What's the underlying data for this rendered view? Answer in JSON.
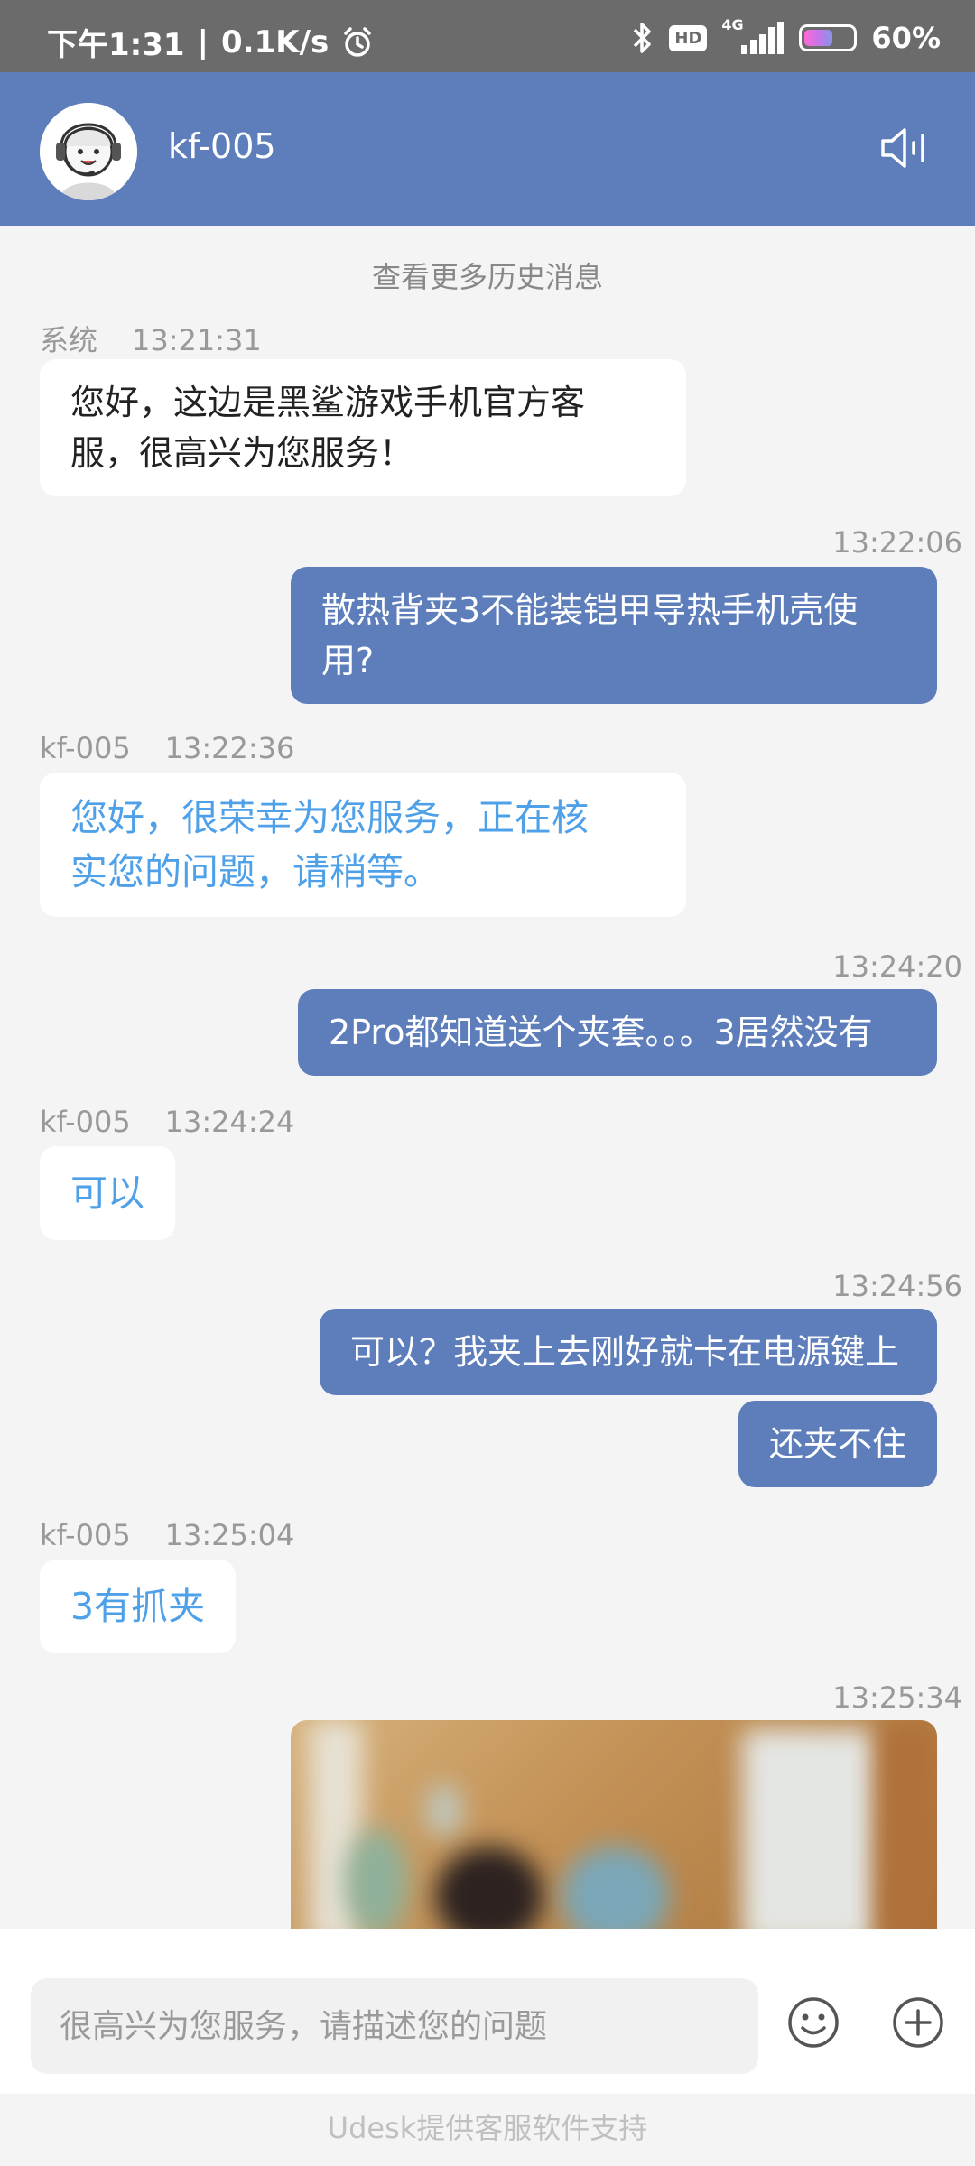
{
  "status_bar": {
    "time": "下午1:31",
    "separator": "|",
    "speed": "0.1K/s",
    "network": "4G",
    "hd": "HD",
    "battery": "60%",
    "battery_level": 0.6
  },
  "header": {
    "agent_name": "kf-005"
  },
  "chat": {
    "more_history": "查看更多历史消息",
    "messages": [
      {
        "sender": "系统",
        "time": "13:21:31",
        "lines": [
          "您好，这边是黑鲨游戏手机官方客",
          "服，很高兴为您服务！"
        ]
      },
      {
        "time": "13:22:06",
        "lines": [
          "散热背夹3不能装铠甲导热手机壳使",
          "用?"
        ]
      },
      {
        "sender": "kf-005",
        "time": "13:22:36",
        "lines": [
          "您好，很荣幸为您服务，正在核",
          "实您的问题，请稍等。"
        ]
      },
      {
        "time": "13:24:20",
        "text": "2Pro都知道送个夹套。。。3居然没有"
      },
      {
        "sender": "kf-005",
        "time": "13:24:24",
        "text": "可以"
      },
      {
        "time": "13:24:56",
        "text": "可以？我夹上去刚好就卡在电源键上"
      },
      {
        "text": "还夹不住"
      },
      {
        "sender": "kf-005",
        "time": "13:25:04",
        "text": "3有抓夹"
      },
      {
        "time": "13:25:34"
      }
    ]
  },
  "input": {
    "placeholder": "很高兴为您服务，请描述您的问题"
  },
  "footer": {
    "text": "Udesk提供客服软件支持"
  },
  "icons": {
    "voice": "speaker-icon",
    "emoji": "smiley-icon",
    "plus": "plus-icon",
    "alarm": "alarm-icon",
    "bluetooth": "bluetooth-icon",
    "signal": "signal-icon"
  },
  "colors": {
    "header": "#5d7ebb",
    "outgoing_bubble": "#5d7ebb",
    "agent_text": "#4ea0e8",
    "background": "#f4f4f4"
  }
}
